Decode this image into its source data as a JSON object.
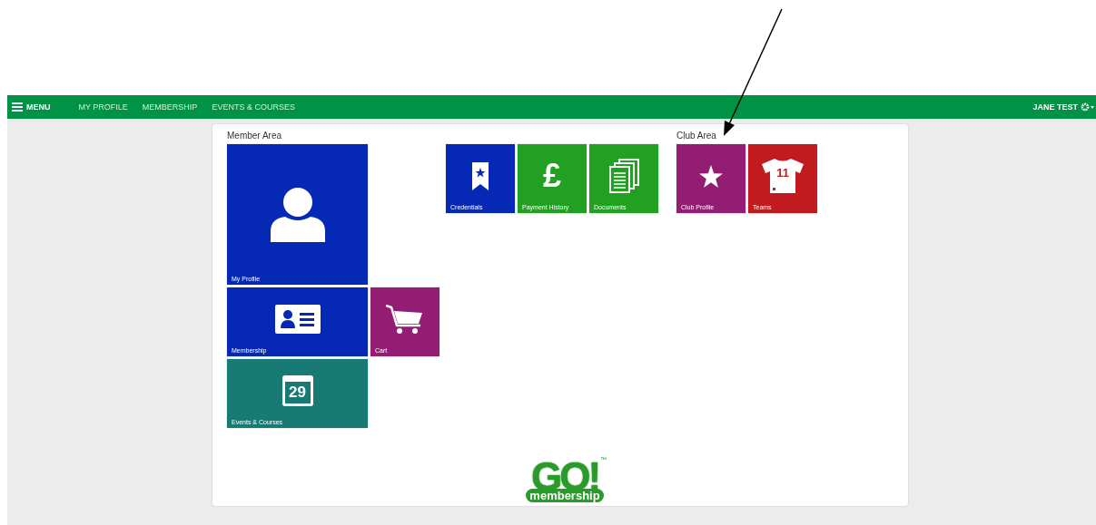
{
  "navbar": {
    "menu_label": "MENU",
    "items": [
      "MY PROFILE",
      "MEMBERSHIP",
      "EVENTS & COURSES"
    ],
    "user": "JANE TEST"
  },
  "sections": [
    {
      "title": "Member Area",
      "tiles": [
        {
          "label": "My Profile",
          "color": "#0529b5"
        },
        {
          "label": "Membership",
          "color": "#0529b5"
        },
        {
          "label": "Cart",
          "color": "#931d72"
        },
        {
          "label": "Events & Courses",
          "color": "#187a74",
          "icon_text": "29"
        },
        {
          "label": "Credentials",
          "color": "#0529b5"
        },
        {
          "label": "Payment History",
          "color": "#22a022",
          "icon_text": "£"
        },
        {
          "label": "Documents",
          "color": "#22a022"
        }
      ]
    },
    {
      "title": "Club Area",
      "tiles": [
        {
          "label": "Club Profile",
          "color": "#931d72"
        },
        {
          "label": "Teams",
          "color": "#c11b1f",
          "icon_text": "11"
        }
      ]
    }
  ],
  "logo": {
    "wordmark": "GO!",
    "tagline": "membership",
    "trademark": "™"
  }
}
